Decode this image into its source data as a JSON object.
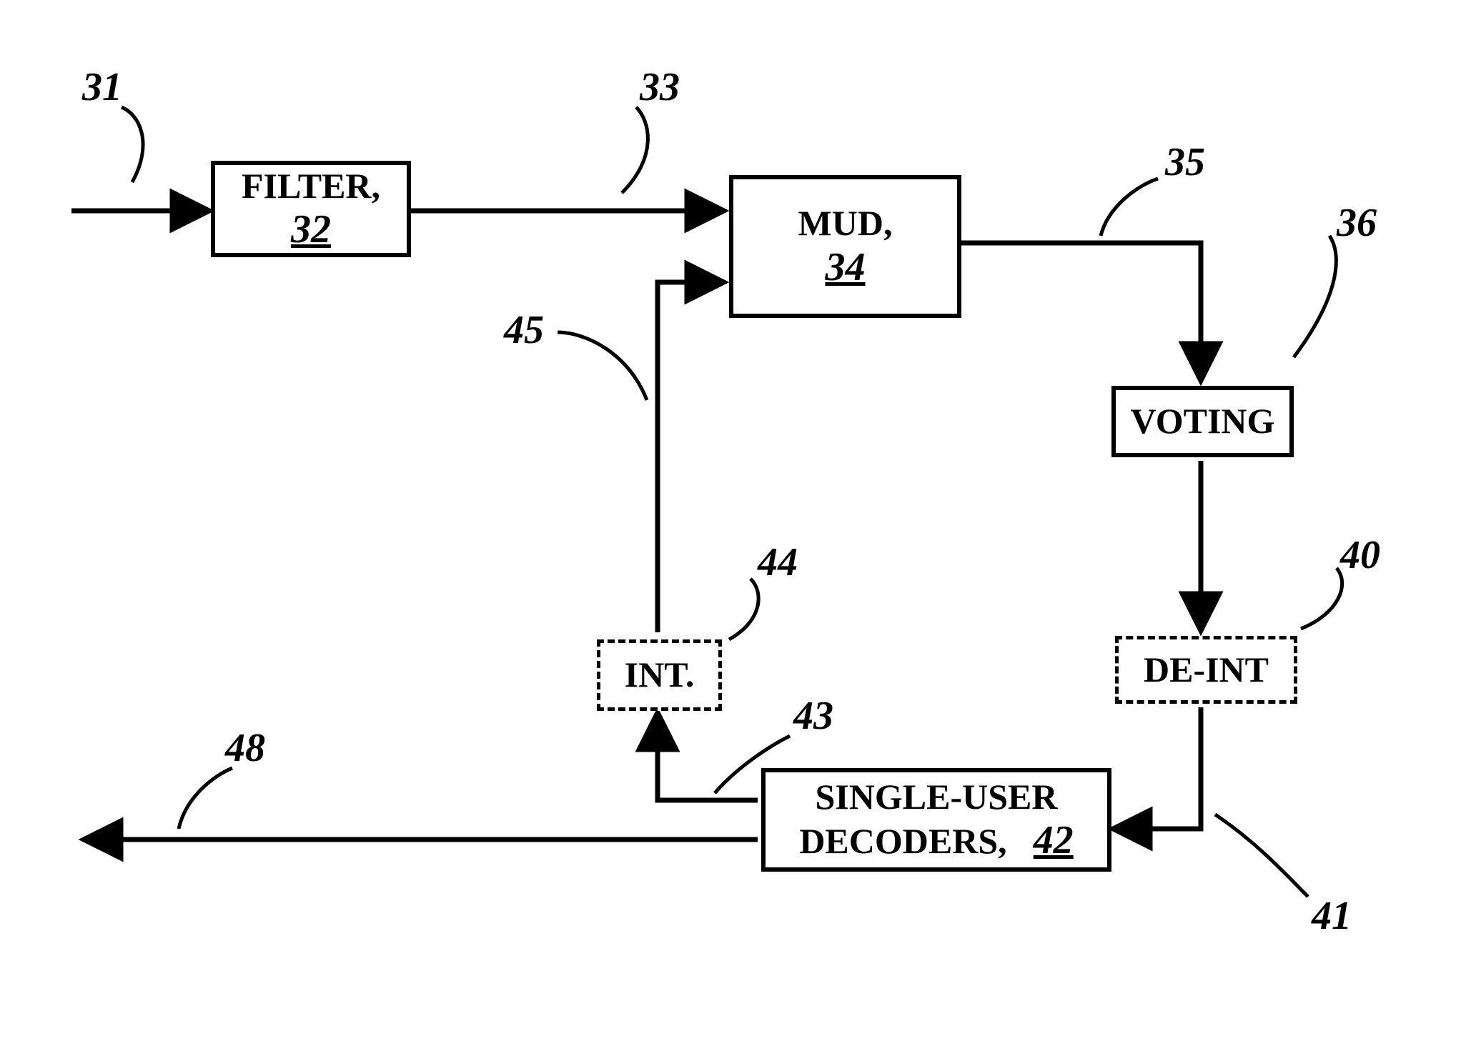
{
  "blocks": {
    "filter": {
      "label": "FILTER,",
      "ref": "32"
    },
    "mud": {
      "label": "MUD,",
      "ref": "34"
    },
    "voting": {
      "label": "VOTING"
    },
    "deint": {
      "label": "DE-INT"
    },
    "decoders": {
      "label1": "SINGLE-USER",
      "label2": "DECODERS,",
      "ref": "42"
    },
    "int": {
      "label": "INT."
    }
  },
  "callouts": {
    "c31": "31",
    "c33": "33",
    "c35": "35",
    "c36": "36",
    "c40": "40",
    "c41": "41",
    "c43": "43",
    "c44": "44",
    "c45": "45",
    "c48": "48"
  }
}
